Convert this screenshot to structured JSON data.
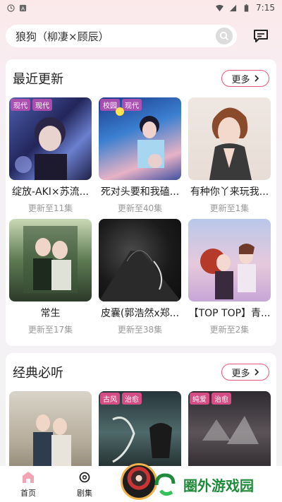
{
  "status": {
    "time": "7:15"
  },
  "search": {
    "query": "狼狗（柳凄×顾辰）"
  },
  "recent": {
    "title": "最近更新",
    "more": "更多",
    "items": [
      {
        "title": "绽放-AKI×苏流...",
        "sub": "更新至11集",
        "tags": [
          "现代",
          "现代"
        ]
      },
      {
        "title": "死对头要和我磕...",
        "sub": "更新至40集",
        "tags": [
          "校园",
          "现代"
        ]
      },
      {
        "title": "有种你丫来玩我...",
        "sub": "更新至1集",
        "tags": []
      },
      {
        "title": "常生",
        "sub": "更新至17集",
        "tags": []
      },
      {
        "title": "皮囊(郭浩然x郑...",
        "sub": "更新至38集",
        "tags": []
      },
      {
        "title": "【TOP TOP】青...",
        "sub": "更新至2集",
        "tags": []
      }
    ]
  },
  "classic": {
    "title": "经典必听",
    "more": "更多",
    "items": [
      {
        "tags": []
      },
      {
        "tags": [
          "古风",
          "治愈"
        ]
      },
      {
        "tags": [
          "纯爱",
          "治愈"
        ]
      }
    ]
  },
  "nav": {
    "home": "首页",
    "series": "剧集"
  },
  "watermark": "圈外游戏园"
}
